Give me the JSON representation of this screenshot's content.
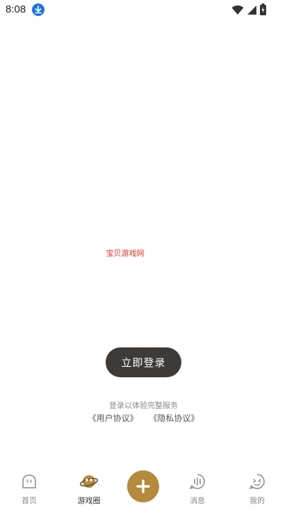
{
  "status_bar": {
    "time": "8:08",
    "icons": [
      "download-icon",
      "wifi-icon",
      "signal-icon",
      "battery-icon"
    ]
  },
  "watermark": {
    "text": "宝贝游戏网",
    "color": "#e4321f"
  },
  "login": {
    "button_label": "立即登录",
    "hint": "登录以体验完整服务",
    "user_agreement": "《用户协议》",
    "privacy_agreement": "《隐私协议》"
  },
  "tabbar": {
    "tabs": [
      {
        "label": "首页",
        "icon": "home-icon"
      },
      {
        "label": "游戏圈",
        "icon": "planet-icon",
        "active": true
      },
      {
        "label": "消息",
        "icon": "message-icon"
      },
      {
        "label": "我的",
        "icon": "profile-icon"
      }
    ],
    "publish_icon": "plus-icon"
  },
  "colors": {
    "accent": "#b58a3c",
    "button_dark": "#3d3a38",
    "watermark": "#e4321f"
  }
}
